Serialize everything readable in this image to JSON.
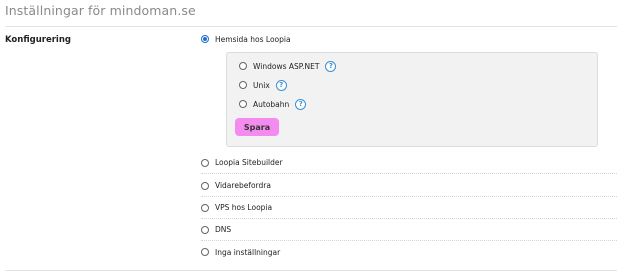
{
  "page": {
    "title": "Inställningar för mindoman.se"
  },
  "settings": {
    "label": "Konfigurering",
    "primary_option": "Hemsida hos Loopia",
    "sub_options": [
      {
        "label": "Windows ASP.NET",
        "help": "?"
      },
      {
        "label": "Unix",
        "help": "?"
      },
      {
        "label": "Autobahn",
        "help": "?"
      }
    ],
    "save_label": "Spara",
    "other_options": [
      "Loopia Sitebuilder",
      "Vidarebefordra",
      "VPS hos Loopia",
      "DNS",
      "Inga inställningar"
    ]
  },
  "colors": {
    "accent_button": "#f48cf0",
    "radio_checked": "#1f6fd6",
    "help_icon": "#3a8fd6",
    "panel_bg": "#f2f2f2"
  }
}
